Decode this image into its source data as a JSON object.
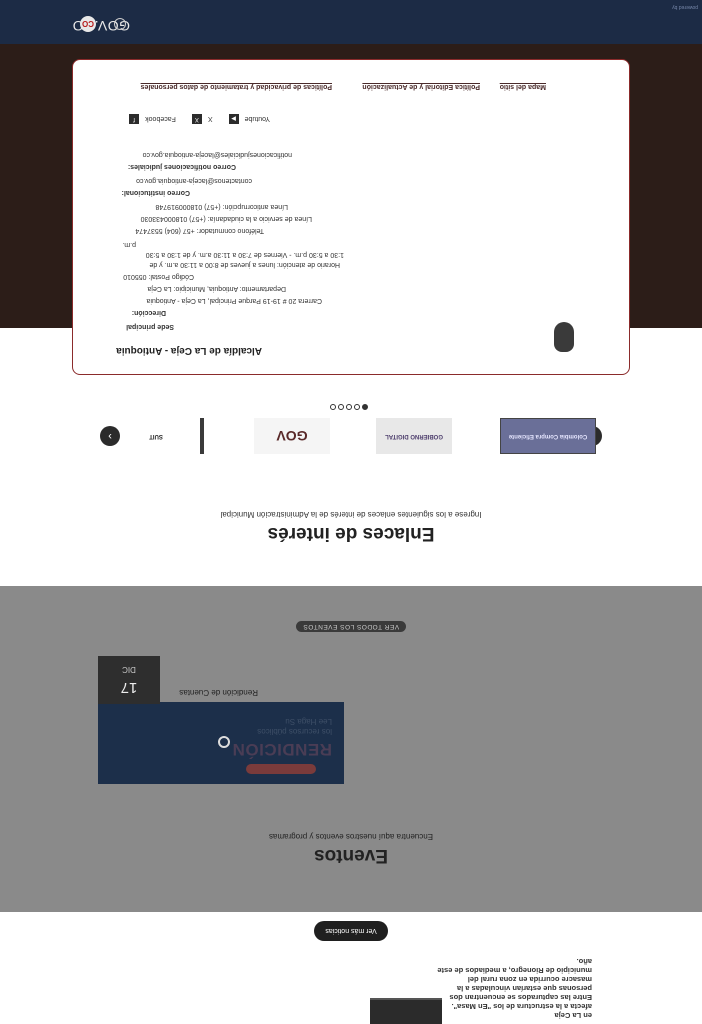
{
  "news": {
    "text": "afecta a la estructura de los \"En Masa\". Entre las capturados se encuentran dos personas que estarían vinculadas a la masacre ocurrida en zona rural del municipio de Rionegro, a mediados de este año.",
    "prefix": "en La Ceja",
    "button": "Ver más noticias"
  },
  "events": {
    "title": "Eventos",
    "subtitle": "Encuentra aquí nuestros eventos y programas",
    "event_name": "Rendición de Cuentas",
    "image_title": "RENDICIÓN",
    "image_line1": "los recursos públicos",
    "image_line2": "Lee Haga Su",
    "date_day": "17",
    "date_month": "DIC",
    "all_button": "VER TODOS LOS EVENTOS"
  },
  "enlaces": {
    "title": "Enlaces de interés",
    "subtitle": "Ingrese a los siguientes enlaces de interés de la Administración Municipal",
    "logos": [
      {
        "name": "Colombia Compra Eficiente"
      },
      {
        "name": "GOBIERNO DIGITAL"
      },
      {
        "name": "GOV"
      },
      {
        "name": "SUIT"
      }
    ],
    "prev_icon": "chevron-left-icon",
    "next_icon": "chevron-right-icon",
    "dots": 5,
    "active_dot": 0
  },
  "footer": {
    "title": "Alcaldía de La Ceja - Antioquia",
    "sede": "Sede principal",
    "direccion_label": "Dirección:",
    "direccion": "Carrera 20 # 19-19 Parque Principal, La Ceja - Antioquia",
    "departamento": "Departamento: Antioquia, Municipio: La Ceja",
    "codigo_postal": "Código Postal: 055010",
    "horario": "Horario de atención: lunes a jueves de 8:00 a 11:30 a.m. y de",
    "horario2": "1:30 a 5:30 p.m. - Viernes de 7:30 a 11:30 a.m. y de 1:30 a 5:30",
    "horario3": "p.m.",
    "telefono": "Teléfono conmutador: +57 (604) 5537474",
    "linea_servicio": "Línea de servicio a la ciudadanía: (+57) 018000433030",
    "linea_anticorrupcion": "Línea anticorrupción: (+57) 018000919748",
    "correo_institucional_label": "Correo institucional:",
    "correo_institucional": "contactenos@laceja-antioquia.gov.co",
    "correo_notificaciones_label": "Correo notificaciones judiciales:",
    "correo_notificaciones": "notificacionesjudiciales@laceja-antioquia.gov.co",
    "social": [
      {
        "icon": "facebook-icon",
        "glyph": "f",
        "label": "Facebook"
      },
      {
        "icon": "x-icon",
        "glyph": "X",
        "label": "X"
      },
      {
        "icon": "youtube-icon",
        "glyph": "▶",
        "label": "Youtube"
      }
    ],
    "links": [
      "Políticas de privacidad y tratamiento de datos personales",
      "Política Editorial y de Actualización",
      "Mapa del sitio"
    ]
  },
  "brand": {
    "name": "GOV.CO",
    "badge": "CO"
  },
  "powered": "powered by"
}
